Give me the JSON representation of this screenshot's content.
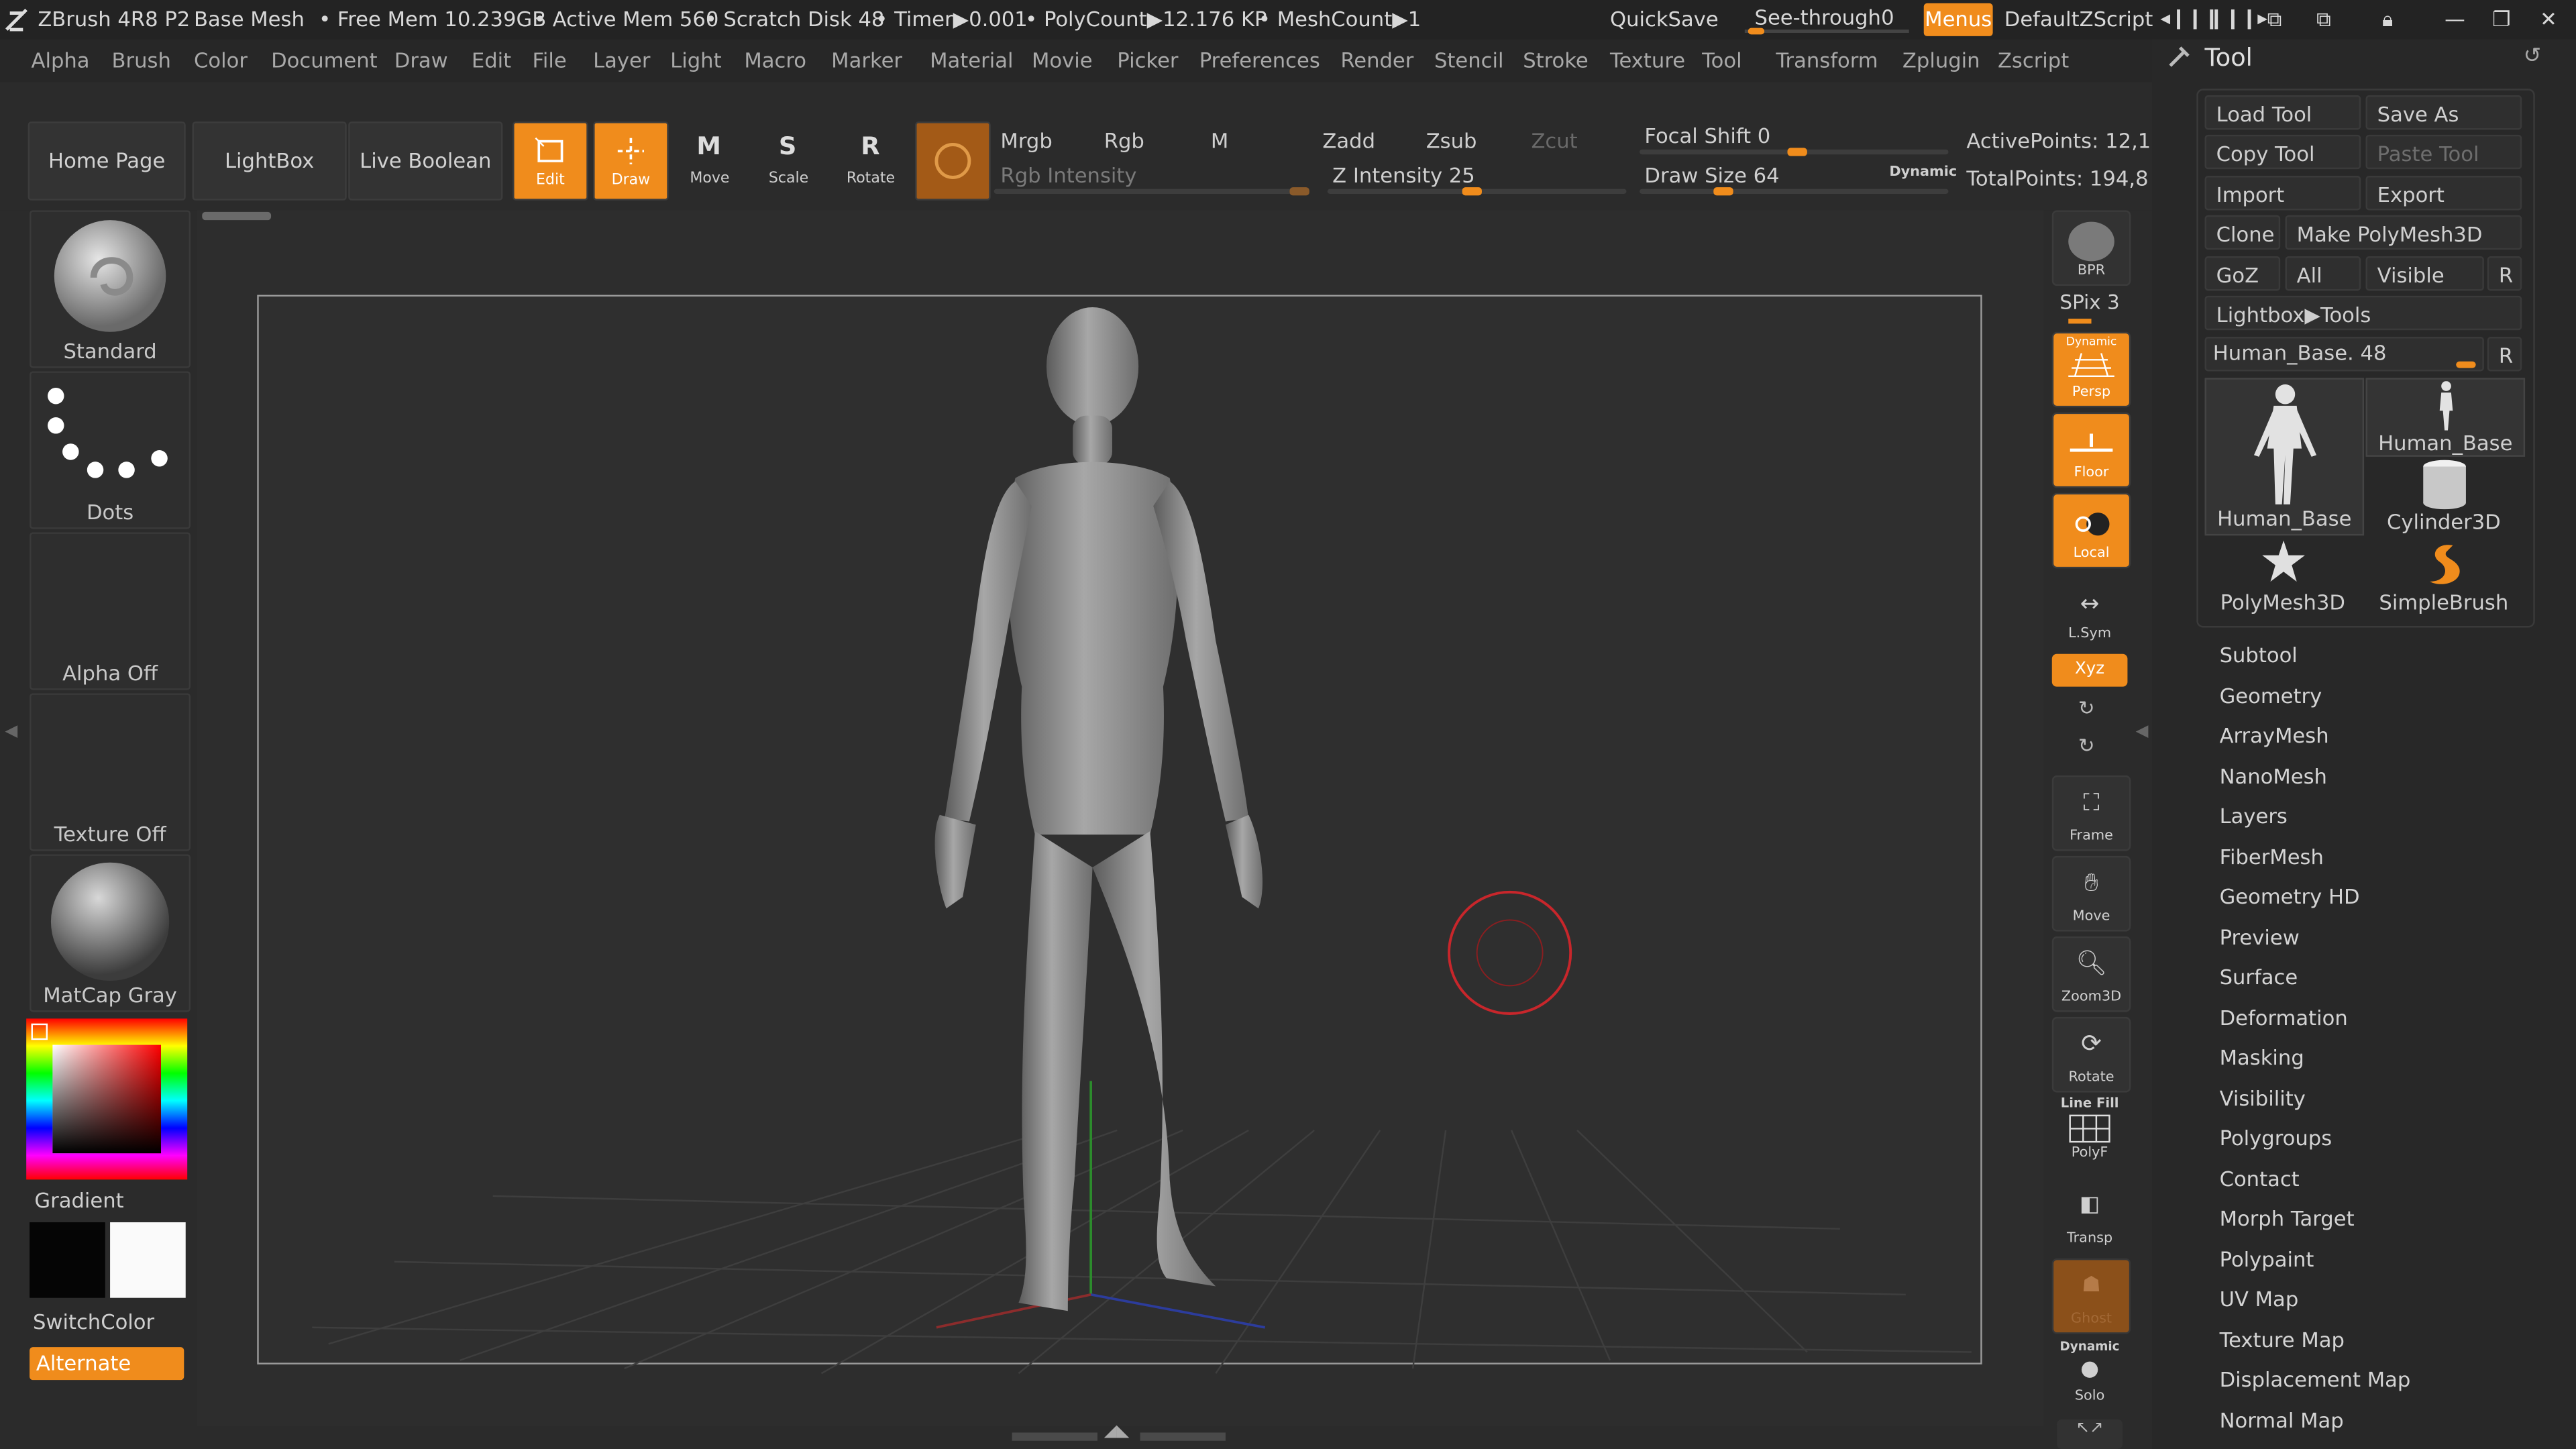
{
  "title_bar": {
    "app": "ZBrush 4R8 P2",
    "document": "Base Mesh",
    "free_mem": "• Free Mem 10.239GB",
    "active_mem": "• Active Mem 560",
    "scratch_disk": "• Scratch Disk 48",
    "timer": "• Timer▶0.001",
    "poly_count": "• PolyCount▶12.176 KP",
    "mesh_count": "• MeshCount▶1",
    "quicksave": "QuickSave",
    "see_through": "See-through",
    "see_through_value": "0",
    "menus": "Menus",
    "zscript": "DefaultZScript"
  },
  "menu_bar": [
    "Alpha",
    "Brush",
    "Color",
    "Document",
    "Draw",
    "Edit",
    "File",
    "Layer",
    "Light",
    "Macro",
    "Marker",
    "Material",
    "Movie",
    "Picker",
    "Preferences",
    "Render",
    "Stencil",
    "Stroke",
    "Texture",
    "Tool",
    "Transform",
    "Zplugin",
    "Zscript"
  ],
  "top_shelf": {
    "home_page": "Home Page",
    "lightbox": "LightBox",
    "live_boolean": "Live Boolean",
    "edit": "Edit",
    "draw": "Draw",
    "move": "Move",
    "scale": "Scale",
    "rotate": "Rotate",
    "mrgb": "Mrgb",
    "rgb": "Rgb",
    "m": "M",
    "rgb_intensity": "Rgb Intensity",
    "zadd": "Zadd",
    "zsub": "Zsub",
    "zcut": "Zcut",
    "z_intensity": "Z Intensity 25",
    "focal_shift": "Focal Shift 0",
    "draw_size": "Draw Size 64",
    "dynamic": "Dynamic",
    "active_points": "ActivePoints: 12,1",
    "total_points": "TotalPoints: 194,8"
  },
  "left_shelf": {
    "brush": "Standard",
    "stroke": "Dots",
    "alpha": "Alpha Off",
    "texture": "Texture Off",
    "material": "MatCap Gray",
    "gradient": "Gradient",
    "switch_color": "SwitchColor",
    "alternate": "Alternate"
  },
  "right_shelf": {
    "bpr": "BPR",
    "spix": "SPix 3",
    "persp_dynamic": "Dynamic",
    "persp": "Persp",
    "floor": "Floor",
    "local": "Local",
    "lsym": "L.Sym",
    "xyz": "Xyz",
    "frame": "Frame",
    "move": "Move",
    "zoom3d": "Zoom3D",
    "rotate": "Rotate",
    "linefill": "Line Fill",
    "polyf": "PolyF",
    "transp": "Transp",
    "ghost": "Ghost",
    "solo_dynamic": "Dynamic",
    "solo": "Solo"
  },
  "tool_panel": {
    "title": "Tool",
    "load_tool": "Load Tool",
    "save_as": "Save As",
    "copy_tool": "Copy Tool",
    "paste_tool": "Paste Tool",
    "import": "Import",
    "export": "Export",
    "clone": "Clone",
    "make_polymesh": "Make PolyMesh3D",
    "goz": "GoZ",
    "all": "All",
    "visible": "Visible",
    "r": "R",
    "lightbox_tools": "Lightbox▶Tools",
    "current_tool": "Human_Base. 48",
    "thumbs": [
      "Human_Base",
      "Human_Base",
      "Cylinder3D",
      "PolyMesh3D",
      "SimpleBrush"
    ],
    "sections": [
      "Subtool",
      "Geometry",
      "ArrayMesh",
      "NanoMesh",
      "Layers",
      "FiberMesh",
      "Geometry HD",
      "Preview",
      "Surface",
      "Deformation",
      "Masking",
      "Visibility",
      "Polygroups",
      "Contact",
      "Morph Target",
      "Polypaint",
      "UV Map",
      "Texture Map",
      "Displacement Map",
      "Normal Map"
    ]
  },
  "colors": {
    "accent": "#f08c1c",
    "background": "#2b2b2b",
    "brush_circle": "#c8262b"
  }
}
